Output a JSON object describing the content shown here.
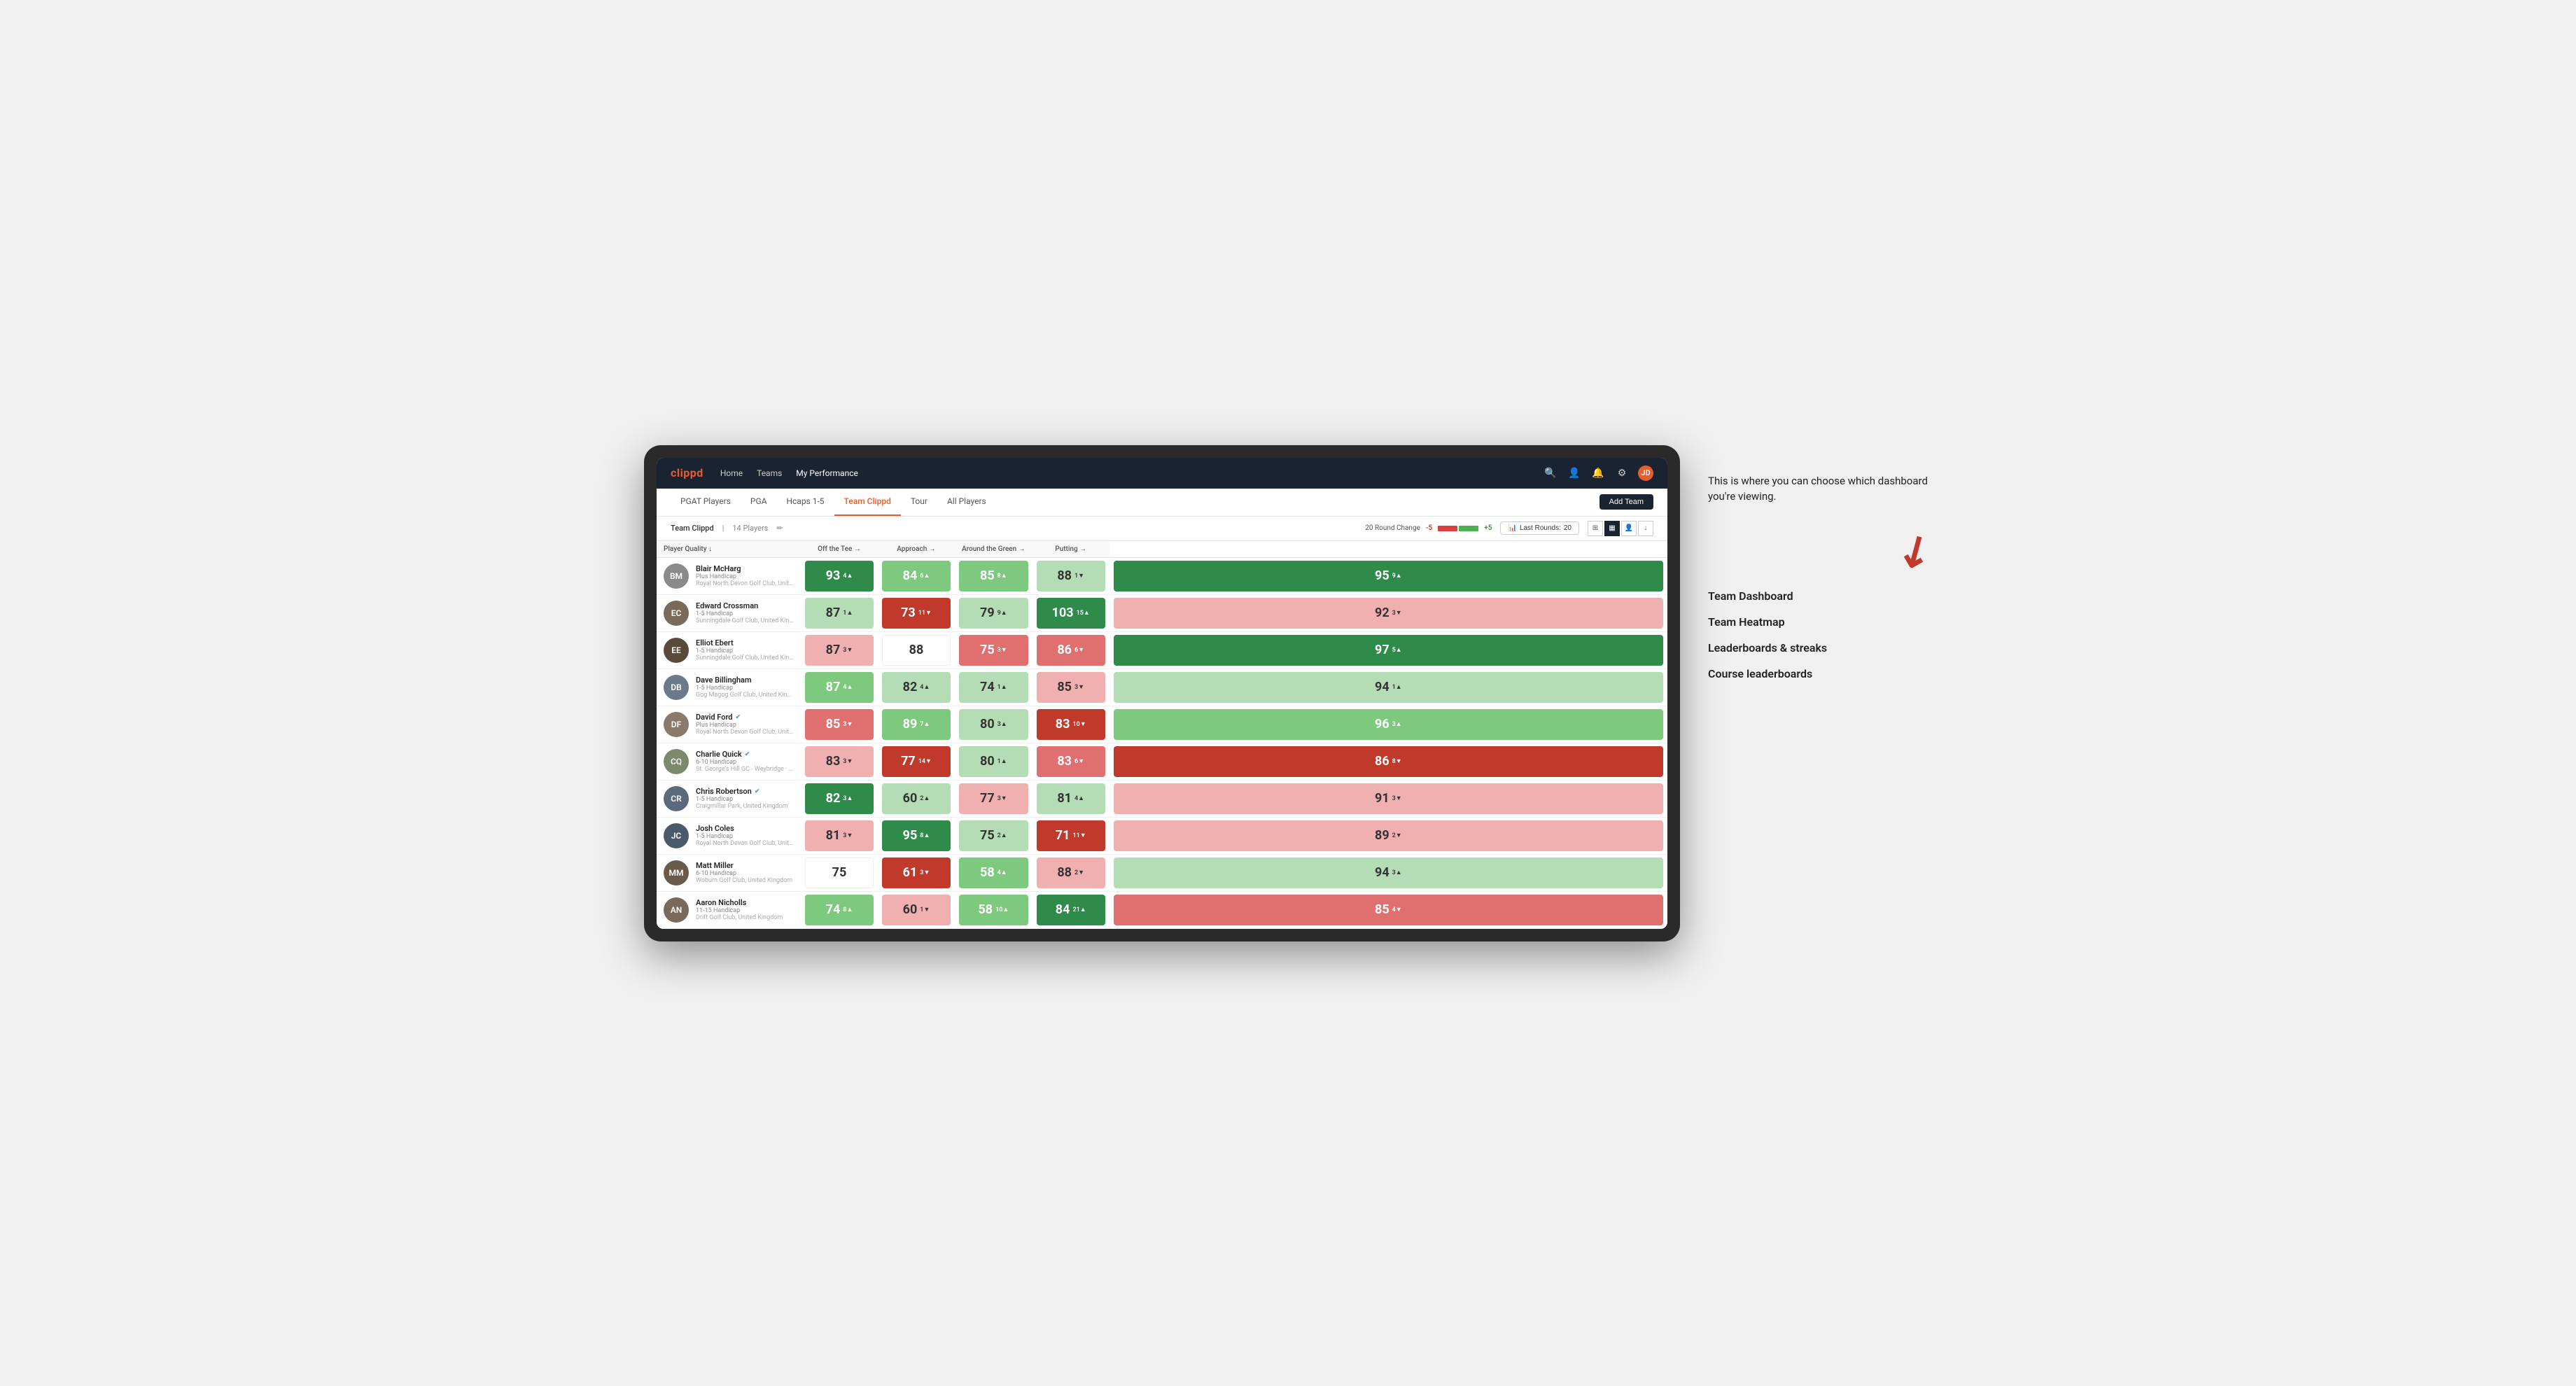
{
  "annotation": {
    "tooltip_text": "This is where you can choose which dashboard you're viewing.",
    "arrow_char": "↙",
    "dashboard_options": [
      "Team Dashboard",
      "Team Heatmap",
      "Leaderboards & streaks",
      "Course leaderboards"
    ]
  },
  "nav": {
    "logo": "clippd",
    "links": [
      {
        "label": "Home",
        "active": false
      },
      {
        "label": "Teams",
        "active": false
      },
      {
        "label": "My Performance",
        "active": true
      }
    ],
    "icons": {
      "search": "🔍",
      "user": "👤",
      "bell": "🔔",
      "settings": "⚙",
      "avatar_initials": "JD"
    }
  },
  "sub_nav": {
    "links": [
      {
        "label": "PGAT Players",
        "active": false
      },
      {
        "label": "PGA",
        "active": false
      },
      {
        "label": "Hcaps 1-5",
        "active": false
      },
      {
        "label": "Team Clippd",
        "active": true
      },
      {
        "label": "Tour",
        "active": false
      },
      {
        "label": "All Players",
        "active": false
      }
    ],
    "add_team_label": "Add Team"
  },
  "team_row": {
    "team_name": "Team Clippd",
    "separator": "|",
    "player_count": "14 Players",
    "round_change_label": "20 Round Change",
    "round_change_neg": "-5",
    "round_change_pos": "+5",
    "last_rounds_label": "Last Rounds:",
    "last_rounds_value": "20",
    "view_icon_grid": "⊞",
    "view_icon_table": "≡",
    "view_icon_person": "👤",
    "view_icon_download": "↓"
  },
  "table": {
    "columns": [
      {
        "label": "Player Quality ↓",
        "key": "player_quality"
      },
      {
        "label": "Off the Tee →",
        "key": "off_tee"
      },
      {
        "label": "Approach →",
        "key": "approach"
      },
      {
        "label": "Around the Green →",
        "key": "around_green"
      },
      {
        "label": "Putting →",
        "key": "putting"
      }
    ],
    "rows": [
      {
        "name": "Blair McHarg",
        "handicap": "Plus Handicap",
        "club": "Royal North Devon Golf Club, United Kingdom",
        "avatar_color": "#8a8a8a",
        "avatar_initials": "BM",
        "player_quality": {
          "value": 93,
          "change": "4",
          "dir": "up",
          "color": "green-dark"
        },
        "off_tee": {
          "value": 84,
          "change": "6",
          "dir": "up",
          "color": "green-light"
        },
        "approach": {
          "value": 85,
          "change": "8",
          "dir": "up",
          "color": "green-light"
        },
        "around_green": {
          "value": 88,
          "change": "1",
          "dir": "down",
          "color": "green-pale"
        },
        "putting": {
          "value": 95,
          "change": "9",
          "dir": "up",
          "color": "green-dark"
        }
      },
      {
        "name": "Edward Crossman",
        "handicap": "1-5 Handicap",
        "club": "Sunningdale Golf Club, United Kingdom",
        "avatar_color": "#7a6a5a",
        "avatar_initials": "EC",
        "player_quality": {
          "value": 87,
          "change": "1",
          "dir": "up",
          "color": "green-pale"
        },
        "off_tee": {
          "value": 73,
          "change": "11",
          "dir": "down",
          "color": "red-dark"
        },
        "approach": {
          "value": 79,
          "change": "9",
          "dir": "up",
          "color": "green-pale"
        },
        "around_green": {
          "value": 103,
          "change": "15",
          "dir": "up",
          "color": "green-dark"
        },
        "putting": {
          "value": 92,
          "change": "3",
          "dir": "down",
          "color": "red-pale"
        }
      },
      {
        "name": "Elliot Ebert",
        "handicap": "1-5 Handicap",
        "club": "Sunningdale Golf Club, United Kingdom",
        "avatar_color": "#5a4a3a",
        "avatar_initials": "EE",
        "player_quality": {
          "value": 87,
          "change": "3",
          "dir": "down",
          "color": "red-pale"
        },
        "off_tee": {
          "value": 88,
          "change": "",
          "dir": "none",
          "color": "white"
        },
        "approach": {
          "value": 75,
          "change": "3",
          "dir": "down",
          "color": "red-light"
        },
        "around_green": {
          "value": 86,
          "change": "6",
          "dir": "down",
          "color": "red-light"
        },
        "putting": {
          "value": 97,
          "change": "5",
          "dir": "up",
          "color": "green-dark"
        }
      },
      {
        "name": "Dave Billingham",
        "handicap": "1-5 Handicap",
        "club": "Gog Magog Golf Club, United Kingdom",
        "avatar_color": "#6a7a8a",
        "avatar_initials": "DB",
        "player_quality": {
          "value": 87,
          "change": "4",
          "dir": "up",
          "color": "green-light"
        },
        "off_tee": {
          "value": 82,
          "change": "4",
          "dir": "up",
          "color": "green-pale"
        },
        "approach": {
          "value": 74,
          "change": "1",
          "dir": "up",
          "color": "green-pale"
        },
        "around_green": {
          "value": 85,
          "change": "3",
          "dir": "down",
          "color": "red-pale"
        },
        "putting": {
          "value": 94,
          "change": "1",
          "dir": "up",
          "color": "green-pale"
        }
      },
      {
        "name": "David Ford",
        "handicap": "Plus Handicap",
        "club": "Royal North Devon Golf Club, United Kingdom",
        "avatar_color": "#8a7a6a",
        "avatar_initials": "DF",
        "verified": true,
        "player_quality": {
          "value": 85,
          "change": "3",
          "dir": "down",
          "color": "red-light"
        },
        "off_tee": {
          "value": 89,
          "change": "7",
          "dir": "up",
          "color": "green-light"
        },
        "approach": {
          "value": 80,
          "change": "3",
          "dir": "up",
          "color": "green-pale"
        },
        "around_green": {
          "value": 83,
          "change": "10",
          "dir": "down",
          "color": "red-dark"
        },
        "putting": {
          "value": 96,
          "change": "3",
          "dir": "up",
          "color": "green-light"
        }
      },
      {
        "name": "Charlie Quick",
        "handicap": "6-10 Handicap",
        "club": "St. George's Hill GC - Weybridge · Surrey, Uni...",
        "avatar_color": "#7a8a6a",
        "avatar_initials": "CQ",
        "verified": true,
        "player_quality": {
          "value": 83,
          "change": "3",
          "dir": "down",
          "color": "red-pale"
        },
        "off_tee": {
          "value": 77,
          "change": "14",
          "dir": "down",
          "color": "red-dark"
        },
        "approach": {
          "value": 80,
          "change": "1",
          "dir": "up",
          "color": "green-pale"
        },
        "around_green": {
          "value": 83,
          "change": "6",
          "dir": "down",
          "color": "red-light"
        },
        "putting": {
          "value": 86,
          "change": "8",
          "dir": "down",
          "color": "red-dark"
        }
      },
      {
        "name": "Chris Robertson",
        "handicap": "1-5 Handicap",
        "club": "Craigmillar Park, United Kingdom",
        "avatar_color": "#5a6a7a",
        "avatar_initials": "CR",
        "verified": true,
        "player_quality": {
          "value": 82,
          "change": "3",
          "dir": "up",
          "color": "green-dark"
        },
        "off_tee": {
          "value": 60,
          "change": "2",
          "dir": "up",
          "color": "green-pale"
        },
        "approach": {
          "value": 77,
          "change": "3",
          "dir": "down",
          "color": "red-pale"
        },
        "around_green": {
          "value": 81,
          "change": "4",
          "dir": "up",
          "color": "green-pale"
        },
        "putting": {
          "value": 91,
          "change": "3",
          "dir": "down",
          "color": "red-pale"
        }
      },
      {
        "name": "Josh Coles",
        "handicap": "1-5 Handicap",
        "club": "Royal North Devon Golf Club, United Kingdom",
        "avatar_color": "#4a5a6a",
        "avatar_initials": "JC",
        "player_quality": {
          "value": 81,
          "change": "3",
          "dir": "down",
          "color": "red-pale"
        },
        "off_tee": {
          "value": 95,
          "change": "8",
          "dir": "up",
          "color": "green-dark"
        },
        "approach": {
          "value": 75,
          "change": "2",
          "dir": "up",
          "color": "green-pale"
        },
        "around_green": {
          "value": 71,
          "change": "11",
          "dir": "down",
          "color": "red-dark"
        },
        "putting": {
          "value": 89,
          "change": "2",
          "dir": "down",
          "color": "red-pale"
        }
      },
      {
        "name": "Matt Miller",
        "handicap": "6-10 Handicap",
        "club": "Woburn Golf Club, United Kingdom",
        "avatar_color": "#6a5a4a",
        "avatar_initials": "MM",
        "player_quality": {
          "value": 75,
          "change": "",
          "dir": "none",
          "color": "white"
        },
        "off_tee": {
          "value": 61,
          "change": "3",
          "dir": "down",
          "color": "red-dark"
        },
        "approach": {
          "value": 58,
          "change": "4",
          "dir": "up",
          "color": "green-light"
        },
        "around_green": {
          "value": 88,
          "change": "2",
          "dir": "down",
          "color": "red-pale"
        },
        "putting": {
          "value": 94,
          "change": "3",
          "dir": "up",
          "color": "green-pale"
        }
      },
      {
        "name": "Aaron Nicholls",
        "handicap": "11-15 Handicap",
        "club": "Drift Golf Club, United Kingdom",
        "avatar_color": "#7a6a5a",
        "avatar_initials": "AN",
        "player_quality": {
          "value": 74,
          "change": "8",
          "dir": "up",
          "color": "green-light"
        },
        "off_tee": {
          "value": 60,
          "change": "1",
          "dir": "down",
          "color": "red-pale"
        },
        "approach": {
          "value": 58,
          "change": "10",
          "dir": "up",
          "color": "green-light"
        },
        "around_green": {
          "value": 84,
          "change": "21",
          "dir": "up",
          "color": "green-dark"
        },
        "putting": {
          "value": 85,
          "change": "4",
          "dir": "down",
          "color": "red-light"
        }
      }
    ]
  }
}
